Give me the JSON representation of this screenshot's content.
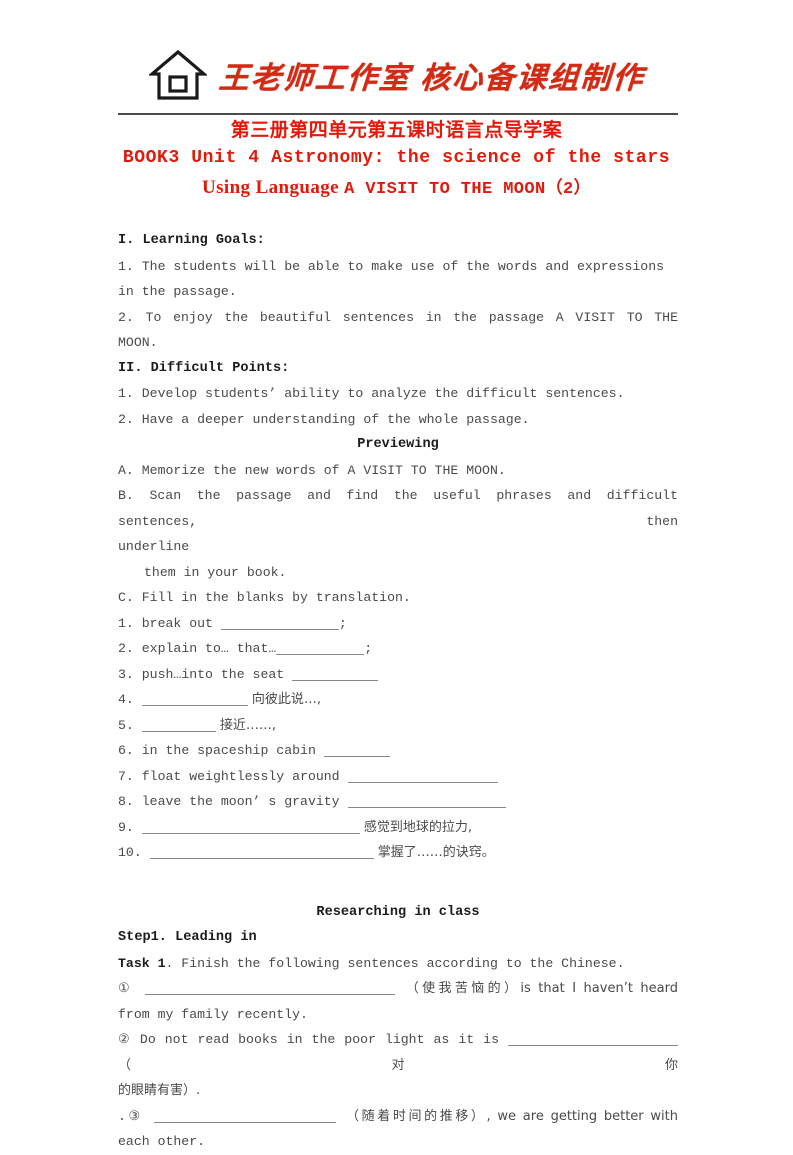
{
  "logo": {
    "icon": "house-icon",
    "text": "王老师工作室 核心备课组制作",
    "color": "#d32b13"
  },
  "titles": {
    "cn": "第三册第四单元第五课时语言点导学案",
    "en_line1": "BOOK3  Unit 4 Astronomy: the science of the stars",
    "en_line2_serif": "Using Language ",
    "en_line2_mono": "A VISIT TO THE MOON（2）",
    "color": "#e01b0c"
  },
  "sections": {
    "learning_goals_heading": "I. Learning Goals:",
    "learning_goals": [
      "1. The students will be able to make use of the words and expressions in the passage.",
      "2. To enjoy the beautiful sentences in the passage A VISIT TO THE MOON."
    ],
    "difficult_points_heading": "II. Difficult Points:",
    "difficult_points": [
      "1. Develop students’ ability to analyze the difficult sentences.",
      "2. Have a deeper understanding of the whole passage."
    ],
    "previewing_heading": "Previewing",
    "previewing": {
      "item_a": "A. Memorize the new words of A VISIT TO THE MOON.",
      "item_b_line1": "B. Scan the passage and find the useful phrases and difficult sentences, then",
      "item_b_line2": "underline",
      "item_b_line3": "them in your book.",
      "item_c": "C. Fill in the blanks by translation."
    },
    "blanks_list": [
      {
        "num": "1.",
        "pre": "break out ",
        "post": ";",
        "blank": "b-w1"
      },
      {
        "num": "2.",
        "pre": "explain to… that…",
        "post": ";",
        "blank": "b-w2"
      },
      {
        "num": "3.",
        "pre": "push…into the seat ",
        "post": "",
        "blank": "b-w3"
      },
      {
        "num": "4.",
        "pre": "",
        "post": " 向彼此说…,",
        "blank": "b-w4"
      },
      {
        "num": "5.",
        "pre": "",
        "post": " 接近……,",
        "blank": "b-w5"
      },
      {
        "num": "6.",
        "pre": "in the spaceship cabin ",
        "post": "",
        "blank": "b-w6"
      },
      {
        "num": "7.",
        "pre": "float weightlessly around ",
        "post": "",
        "blank": "b-w7"
      },
      {
        "num": "8.",
        "pre": "leave the moon’ s gravity ",
        "post": "",
        "blank": "b-w8"
      },
      {
        "num": "9.",
        "pre": "",
        "post": " 感觉到地球的拉力,",
        "blank": "b-w9"
      },
      {
        "num": "10.",
        "pre": "",
        "post": " 掌握了……的诀窍。",
        "blank": "b-w10"
      }
    ],
    "researching_heading": "Researching in class",
    "step1_heading": "Step1. Leading in",
    "task1_bold": "Task 1",
    "task1_rest": ". Finish the following sentences according to the Chinese.",
    "task_items": {
      "item1_num": "①",
      "item1_after_blank": "（使我苦恼的）is that I haven’t heard",
      "item1_line2": "from my family recently.",
      "item2_pre": "② Do not read books in the poor light as it is ",
      "item2_after_blank": "（对你",
      "item2_line2": "的眼睛有害）.",
      "item3_num": ".③",
      "item3_after_blank": "（随着时间的推移）, we are getting better with",
      "item3_line2": "each other."
    }
  }
}
